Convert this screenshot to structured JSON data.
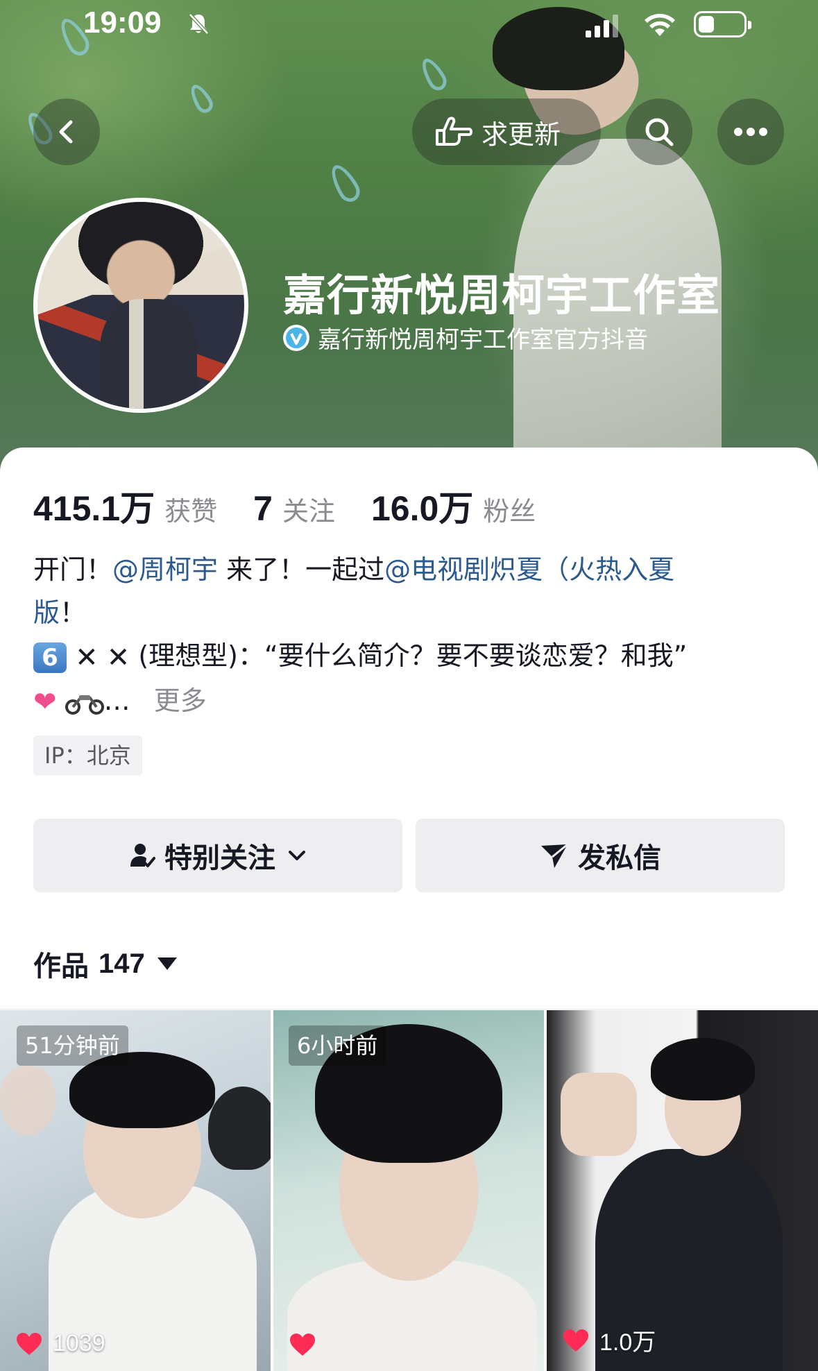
{
  "status_bar": {
    "time": "19:09"
  },
  "nav": {
    "request_update_label": "求更新"
  },
  "profile": {
    "name": "嘉行新悦周柯宇工作室",
    "verified_text": "嘉行新悦周柯宇工作室官方抖音",
    "stats": [
      {
        "value": "415.1万",
        "label": "获赞"
      },
      {
        "value": "7",
        "label": "关注"
      },
      {
        "value": "16.0万",
        "label": "粉丝"
      }
    ],
    "bio": {
      "line1_a": "开门！",
      "mention1": "@周柯宇",
      "line1_b": " 来了！一起过",
      "mention2": "@电视剧炽夏（火热入夏",
      "line2": "版",
      "line2_b": "！",
      "emoji_six": "6",
      "line3": "(理想型)：“要什么简介？要不要谈恋爱？和我”",
      "ellipsis": "…",
      "more": "更多"
    },
    "ip": "IP：北京"
  },
  "actions": {
    "follow_label": "特别关注",
    "message_label": "发私信"
  },
  "works": {
    "label": "作品",
    "count": "147",
    "items": [
      {
        "time": "51分钟前",
        "likes": "1039"
      },
      {
        "time": "6小时前",
        "likes": ""
      },
      {
        "time": "",
        "likes": "1.0万"
      }
    ]
  },
  "colors": {
    "mention": "#2c5a8f",
    "like_heart": "#fe2c55"
  }
}
